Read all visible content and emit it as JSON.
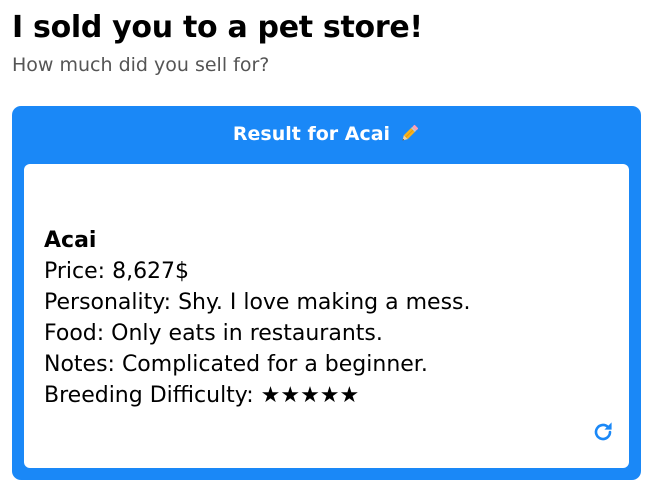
{
  "header": {
    "title": "I sold you to a pet store!",
    "subtitle": "How much did you sell for?"
  },
  "card": {
    "title": "Result for Acai",
    "title_icon": "pencil-icon",
    "accent_color": "#1a88f7",
    "result": {
      "name": "Acai",
      "price": "Price: 8,627$",
      "personality": "Personality: Shy. I love making a mess.",
      "food": "Food: Only eats in restaurants.",
      "notes": "Notes: Complicated for a beginner.",
      "breeding": "Breeding Difficulty: ★★★★★"
    },
    "refresh_icon": "refresh-icon"
  }
}
